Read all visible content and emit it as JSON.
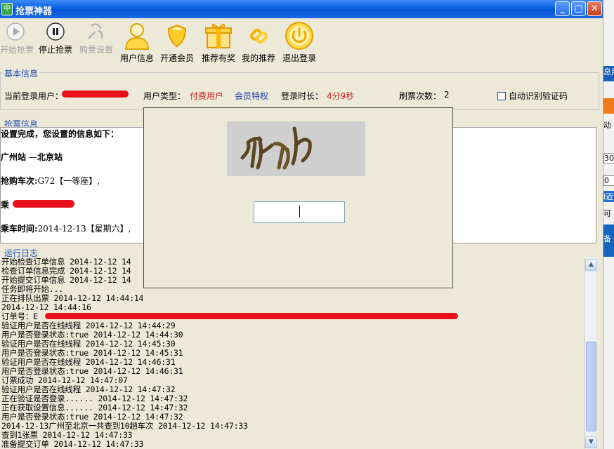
{
  "window": {
    "title": "抢票神器",
    "app_icon_glyph": "中"
  },
  "toolbar": {
    "items": [
      {
        "label": "开始抢票",
        "icon": "play-icon",
        "enabled": false
      },
      {
        "label": "停止抢票",
        "icon": "pause-icon",
        "enabled": true
      },
      {
        "label": "购票设置",
        "icon": "settings-icon",
        "enabled": false
      },
      {
        "label": "用户信息",
        "icon": "user-icon",
        "enabled": true
      },
      {
        "label": "开通会员",
        "icon": "shield-icon",
        "enabled": true
      },
      {
        "label": "推荐有奖",
        "icon": "gift-icon",
        "enabled": true
      },
      {
        "label": "我的推荐",
        "icon": "link-icon",
        "enabled": true
      },
      {
        "label": "退出登录",
        "icon": "power-icon",
        "enabled": true
      }
    ]
  },
  "basic_info": {
    "title": "基本信息",
    "current_user_label": "当前登录用户：",
    "user_type_label": "用户类型：",
    "user_type_value": "付费用户",
    "member_link": "会员特权",
    "login_duration_label": "登录时长：",
    "login_duration_value": "4分9秒",
    "refresh_count_label": "刷票次数：",
    "refresh_count_value": "2",
    "auto_captcha_label": "自动识别验证码"
  },
  "ticket_info": {
    "title": "抢票信息",
    "line1": "设置完成，您设置的信息如下：",
    "station_from": "广州站",
    "station_sep": " —",
    "station_to": "北京站",
    "train_label": "抢购车次:",
    "train_value": "G72【一等座】,",
    "passenger_label": "乘",
    "date_label": "乘车时间:",
    "date_value": "2014-12-13【星期六】,"
  },
  "log": {
    "title": "运行日志",
    "lines": [
      "开始检查订单信息 2014-12-12 14",
      "检查订单信息完成 2014-12-12 14",
      "开始提交订单信息 2014-12-12 14",
      "任务即将开始...",
      "正在排队出票 2014-12-12 14:44:14",
      " 2014-12-12 14:44:16",
      "订单号：E",
      "验证用户是否在线线程 2014-12-12 14:44:29",
      "用户是否登录状态:true 2014-12-12 14:44:30",
      "验证用户是否在线线程 2014-12-12 14:45:30",
      "用户是否登录状态:true 2014-12-12 14:45:31",
      "验证用户是否在线线程 2014-12-12 14:46:31",
      "用户是否登录状态:true 2014-12-12 14:46:31",
      "订票成功 2014-12-12 14:47:07",
      "验证用户是否在线线程 2014-12-12 14:47:32",
      "正在验证是否登录...... 2014-12-12 14:47:32",
      "正在获取设置信息...... 2014-12-12 14:47:32",
      "用户是否登录状态:true 2014-12-12 14:47:32",
      "2014-12-13广州至北京一共查到10趟车次 2014-12-12 14:47:33",
      "查到1张票 2014-12-12 14:47:33",
      "准备提交订单 2014-12-12 14:47:33"
    ]
  },
  "captcha_dialog": {
    "input_value": ""
  },
  "background_app": {
    "strips": [
      "息用",
      "动",
      "30",
      "0",
      "l近多",
      "可",
      "备"
    ]
  },
  "colors": {
    "accent": "#1f4fb4",
    "paid": "#d42020",
    "title_bar": "#0a5fe0"
  }
}
